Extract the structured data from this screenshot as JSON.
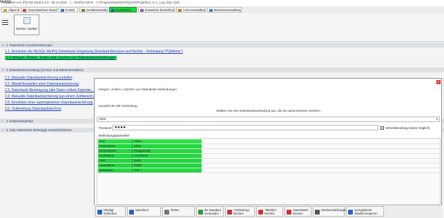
{
  "window": {
    "title": "PQadmin.exe (PQ-DE [x64] 6.4.0 - 28.11.2022 ...) - WinPQ Admin - C:\\ProgramData\\WinPQ\\LOG\\PQadmin_2_1_Log_SQL-SSE"
  },
  "tabs": [
    {
      "label": "Allgemein",
      "active": false,
      "icon_color": "#e0a030"
    },
    {
      "label": "Automatisches Reporting",
      "active": false,
      "icon_color": "#d94040"
    },
    {
      "label": "E-Mail",
      "active": false,
      "icon_color": "#4070d0"
    },
    {
      "label": "Geräteverwaltung",
      "active": false,
      "icon_color": "#6a8a3a"
    },
    {
      "label": "Datenbank",
      "active": true,
      "icon_color": "#3a5fa0"
    },
    {
      "label": "Erweiterte Einstellungen",
      "active": false,
      "icon_color": "#8a5ab0"
    },
    {
      "label": "Lizenzverwaltung",
      "active": false,
      "icon_color": "#c07a20"
    },
    {
      "label": "Benutzerverwaltung",
      "active": false,
      "icon_color": "#3a8ab0"
    }
  ],
  "ribbon": {
    "mysql_update_label": "MySQL-Update",
    "group_label": "MySQL"
  },
  "sections": {
    "s1": "1. Datenbank Grundeinstellungen",
    "s1_links": [
      "1.1. Einrichten der MySQL-WinPQ-Datenbank-Umgebung (Standard-Benutzer und Rechte - Verbindung \"PQAdmin\")",
      "1.2 Anlegen, Ändern, Testen und Löschen von Datenbankverbindungen"
    ],
    "s2": "2. Datenbankverwaltung (Sichern und Wiederherstellen)",
    "s2_links": [
      "2.1. Manuelle Datenbanksicherung erstellen",
      "2.2. Wiederherstellen einer Datenbanksicherung",
      "2.3. Datenbank-Bereinigung (alte Daten mittels Kalender...",
      "2.4. Manuelle Datenbanksicherung aus einem Zeitbereich...",
      "2.5. Einrichten einer automatisierten Datenbanksicherung",
      "2.6. Vorbereitung Datenbankwechsel"
    ],
    "s3": "3. Datenbankpflege",
    "s4": "4. SQL-Datenbank abhängige Zusatzfunktionen"
  },
  "dialog": {
    "title": "Anlegen, Ändern, Löschen von Datenbank-Verbindungen",
    "close_symbol": "x",
    "select_caption": "Auswahl der DB-Verbindung",
    "instruction": "Wählen Sie eine Datenbankverbindung aus, die Sie parametrieren möchten.",
    "connection_value": "VEW",
    "password_label": "Passwort:",
    "password_mask": "●●●●",
    "encryption_checked": true,
    "encryption_label": "Verschlüsselung (wenn möglich)",
    "params_caption": "Verbindungsparameter",
    "params_header": {
      "key": "Key",
      "value": "Value"
    },
    "params": [
      {
        "key": "ConnName",
        "value": "VEW"
      },
      {
        "key": "DriverName",
        "value": "PostgreSQL"
      },
      {
        "key": "HostName",
        "value": "LocalHost"
      },
      {
        "key": "Port",
        "value": "5432"
      },
      {
        "key": "UserName",
        "value": "PQID"
      },
      {
        "key": "DataBase",
        "value": "vew"
      }
    ]
  },
  "toolbar": [
    {
      "label": "Erledigt Schließen",
      "icon": "check-icon",
      "color": "#2a62c9"
    },
    {
      "label": "Speichern",
      "icon": "save-icon",
      "color": "#2a62c9"
    },
    {
      "label": "Testen",
      "icon": "test-icon",
      "color": "#777777"
    },
    {
      "label": "als Standard verwenden",
      "icon": "standard-icon",
      "color": "#2a9a3a"
    },
    {
      "label": "'Verbindung' löschen",
      "icon": "delete-connection-icon",
      "color": "#d03030"
    },
    {
      "label": "'Tabellen' löschen",
      "icon": "delete-tables-icon",
      "color": "#d03030"
    },
    {
      "label": "'Datenbank' löschen",
      "icon": "delete-database-icon",
      "color": "#d03030"
    },
    {
      "label": "Werkseinstellungen",
      "icon": "factory-settings-icon",
      "color": "#555555"
    },
    {
      "label": "Unregistrierte Tabellen kopieren",
      "icon": "copy-tables-icon",
      "color": "#2a62c9"
    }
  ]
}
